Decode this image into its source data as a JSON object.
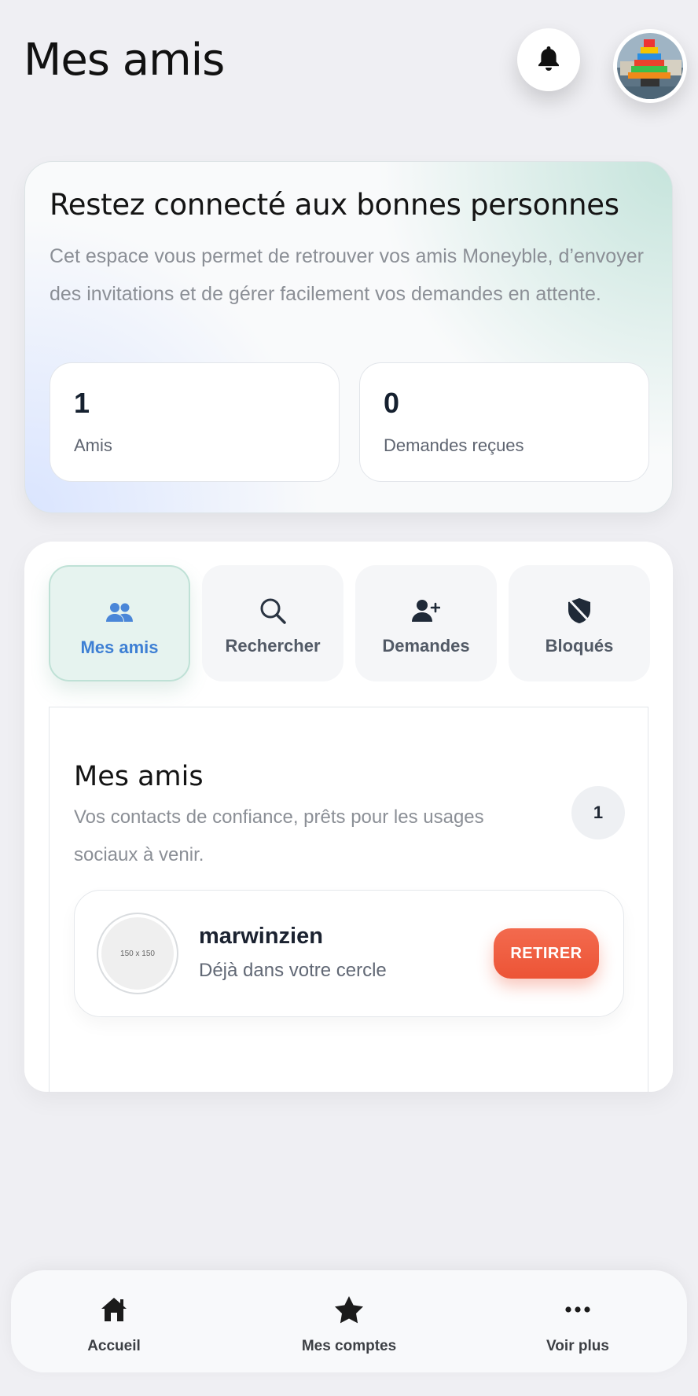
{
  "header": {
    "title": "Mes amis",
    "bell_icon": "bell-icon",
    "avatar_icon": "profile-avatar"
  },
  "intro": {
    "title": "Restez connecté aux bonnes personnes",
    "text": "Cet espace vous permet de retrouver vos amis Moneyble, d’envoyer des invitations et de gérer facilement vos demandes en attente.",
    "stats": [
      {
        "value": "1",
        "label": "Amis"
      },
      {
        "value": "0",
        "label": "Demandes reçues"
      }
    ]
  },
  "tabs": [
    {
      "label": "Mes amis",
      "icon": "users-icon",
      "active": true
    },
    {
      "label": "Rechercher",
      "icon": "search-icon",
      "active": false
    },
    {
      "label": "Demandes",
      "icon": "user-plus-icon",
      "active": false
    },
    {
      "label": "Bloqués",
      "icon": "shield-slash-icon",
      "active": false
    }
  ],
  "friends_section": {
    "title": "Mes amis",
    "description": "Vos contacts de confiance, prêts pour les usages sociaux à venir.",
    "count": "1",
    "friends": [
      {
        "avatar_placeholder": "150 x 150",
        "name": "marwinzien",
        "status": "Déjà dans votre cercle",
        "action_label": "RETIRER"
      }
    ]
  },
  "bottom_nav": [
    {
      "label": "Accueil",
      "icon": "home-icon"
    },
    {
      "label": "Mes comptes",
      "icon": "star-icon"
    },
    {
      "label": "Voir plus",
      "icon": "more-icon"
    }
  ],
  "colors": {
    "accent_blue": "#3d7fd4",
    "active_tab_bg": "#e6f3ef",
    "danger": "#ec5436",
    "background": "#efeff3"
  }
}
